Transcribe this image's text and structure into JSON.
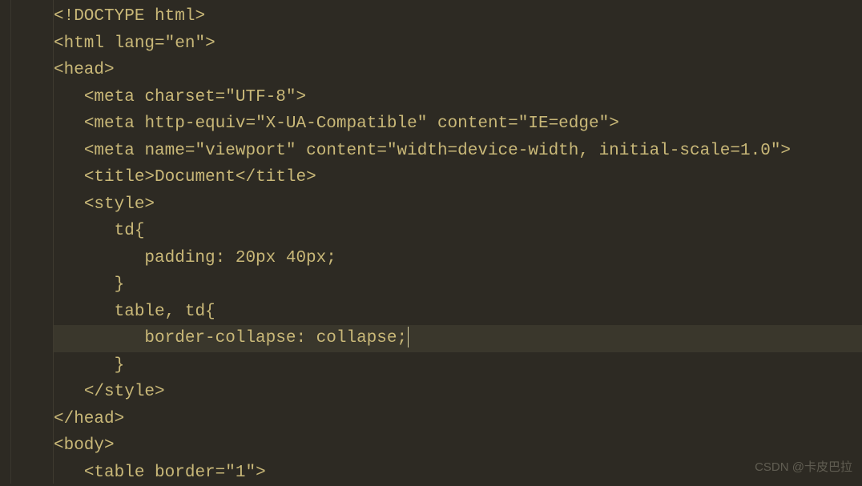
{
  "editor": {
    "lines": [
      {
        "indent": 0,
        "parts": [
          {
            "t": "<!DOCTYPE ",
            "c": "tag"
          },
          {
            "t": "html",
            "c": "attr"
          },
          {
            "t": ">",
            "c": "tag"
          }
        ]
      },
      {
        "indent": 0,
        "parts": [
          {
            "t": "<html ",
            "c": "tag"
          },
          {
            "t": "lang",
            "c": "attr"
          },
          {
            "t": "=",
            "c": "punct"
          },
          {
            "t": "\"en\"",
            "c": "str"
          },
          {
            "t": ">",
            "c": "tag"
          }
        ]
      },
      {
        "indent": 0,
        "parts": [
          {
            "t": "<head>",
            "c": "tag"
          }
        ]
      },
      {
        "indent": 1,
        "parts": [
          {
            "t": "<meta ",
            "c": "tag"
          },
          {
            "t": "charset",
            "c": "attr"
          },
          {
            "t": "=",
            "c": "punct"
          },
          {
            "t": "\"UTF-8\"",
            "c": "str"
          },
          {
            "t": ">",
            "c": "tag"
          }
        ]
      },
      {
        "indent": 1,
        "parts": [
          {
            "t": "<meta ",
            "c": "tag"
          },
          {
            "t": "http-equiv",
            "c": "attr"
          },
          {
            "t": "=",
            "c": "punct"
          },
          {
            "t": "\"X-UA-Compatible\"",
            "c": "str"
          },
          {
            "t": " ",
            "c": "text"
          },
          {
            "t": "content",
            "c": "attr"
          },
          {
            "t": "=",
            "c": "punct"
          },
          {
            "t": "\"IE=edge\"",
            "c": "str"
          },
          {
            "t": ">",
            "c": "tag"
          }
        ]
      },
      {
        "indent": 1,
        "parts": [
          {
            "t": "<meta ",
            "c": "tag"
          },
          {
            "t": "name",
            "c": "attr"
          },
          {
            "t": "=",
            "c": "punct"
          },
          {
            "t": "\"viewport\"",
            "c": "str"
          },
          {
            "t": " ",
            "c": "text"
          },
          {
            "t": "content",
            "c": "attr"
          },
          {
            "t": "=",
            "c": "punct"
          },
          {
            "t": "\"width=device-width, initial-scale=1.0\"",
            "c": "str"
          },
          {
            "t": ">",
            "c": "tag"
          }
        ]
      },
      {
        "indent": 1,
        "parts": [
          {
            "t": "<title>",
            "c": "tag"
          },
          {
            "t": "Document",
            "c": "text"
          },
          {
            "t": "</title>",
            "c": "tag"
          }
        ]
      },
      {
        "indent": 1,
        "parts": [
          {
            "t": "<style>",
            "c": "tag"
          }
        ]
      },
      {
        "indent": 2,
        "parts": [
          {
            "t": "td{",
            "c": "text"
          }
        ]
      },
      {
        "indent": 3,
        "parts": [
          {
            "t": "padding: 20px 40px;",
            "c": "text"
          }
        ]
      },
      {
        "indent": 2,
        "parts": [
          {
            "t": "}",
            "c": "text"
          }
        ]
      },
      {
        "indent": 2,
        "parts": [
          {
            "t": "table, td{",
            "c": "text"
          }
        ]
      },
      {
        "indent": 3,
        "parts": [
          {
            "t": "border-collapse: collapse;",
            "c": "text"
          }
        ],
        "highlighted": true,
        "cursor_after": true
      },
      {
        "indent": 2,
        "parts": [
          {
            "t": "}",
            "c": "text"
          }
        ]
      },
      {
        "indent": 1,
        "parts": [
          {
            "t": "</style>",
            "c": "tag"
          }
        ]
      },
      {
        "indent": 0,
        "parts": [
          {
            "t": "</head>",
            "c": "tag"
          }
        ]
      },
      {
        "indent": 0,
        "parts": [
          {
            "t": "<body>",
            "c": "tag"
          }
        ]
      },
      {
        "indent": 1,
        "parts": [
          {
            "t": "<table ",
            "c": "tag"
          },
          {
            "t": "border",
            "c": "attr"
          },
          {
            "t": "=",
            "c": "punct"
          },
          {
            "t": "\"1\"",
            "c": "str"
          },
          {
            "t": ">",
            "c": "tag"
          }
        ]
      }
    ],
    "watermark": "CSDN @卡皮巴拉"
  }
}
